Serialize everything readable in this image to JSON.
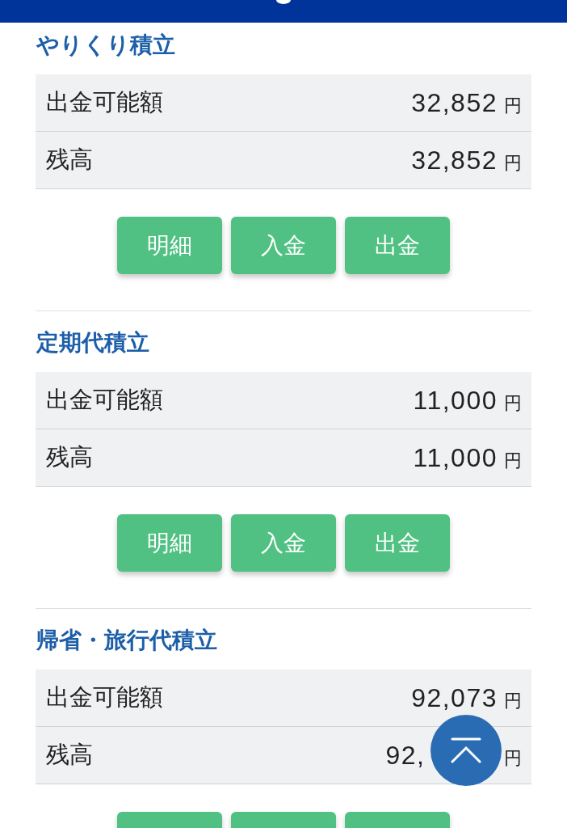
{
  "sections": [
    {
      "title": "やりくり積立",
      "rows": [
        {
          "label": "出金可能額",
          "amount": "32,852",
          "unit": "円",
          "covered": false
        },
        {
          "label": "残高",
          "amount": "32,852",
          "unit": "円",
          "covered": false
        }
      ],
      "buttons": [
        {
          "kind": "labeled",
          "label": "明細"
        },
        {
          "kind": "labeled",
          "label": "入金"
        },
        {
          "kind": "labeled",
          "label": "出金"
        }
      ]
    },
    {
      "title": "定期代積立",
      "rows": [
        {
          "label": "出金可能額",
          "amount": "11,000",
          "unit": "円",
          "covered": false
        },
        {
          "label": "残高",
          "amount": "11,000",
          "unit": "円",
          "covered": false
        }
      ],
      "buttons": [
        {
          "kind": "labeled",
          "label": "明細"
        },
        {
          "kind": "labeled",
          "label": "入金"
        },
        {
          "kind": "labeled",
          "label": "出金"
        }
      ]
    },
    {
      "title": "帰省・旅行代積立",
      "rows": [
        {
          "label": "出金可能額",
          "amount": "92,073",
          "unit": "円",
          "covered": false
        },
        {
          "label": "残高",
          "amount": "92,",
          "unit": "円",
          "covered": true
        }
      ],
      "buttons": [
        {
          "kind": "cropped"
        },
        {
          "kind": "cropped"
        },
        {
          "kind": "cropped"
        }
      ]
    }
  ]
}
